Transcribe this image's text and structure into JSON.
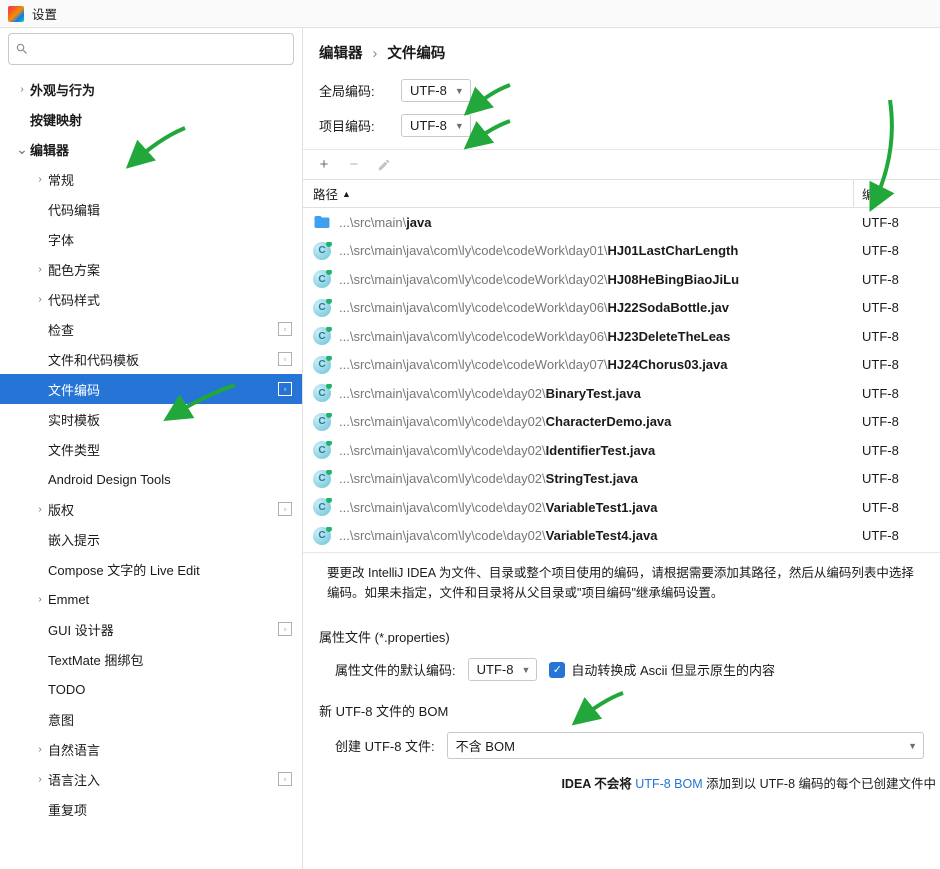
{
  "title": "设置",
  "crumb": {
    "a": "编辑器",
    "b": "文件编码"
  },
  "sidebar": [
    {
      "lvl": 0,
      "exp": "closed",
      "label": "外观与行为"
    },
    {
      "lvl": 0,
      "exp": "none",
      "label": "按键映射"
    },
    {
      "lvl": 0,
      "exp": "open",
      "label": "编辑器"
    },
    {
      "lvl": 1,
      "exp": "closed",
      "label": "常规"
    },
    {
      "lvl": 1,
      "exp": "none",
      "label": "代码编辑"
    },
    {
      "lvl": 1,
      "exp": "none",
      "label": "字体"
    },
    {
      "lvl": 1,
      "exp": "closed",
      "label": "配色方案"
    },
    {
      "lvl": 1,
      "exp": "closed",
      "label": "代码样式"
    },
    {
      "lvl": 1,
      "exp": "none",
      "label": "检查",
      "mark": true
    },
    {
      "lvl": 1,
      "exp": "none",
      "label": "文件和代码模板",
      "mark": true
    },
    {
      "lvl": 1,
      "exp": "none",
      "label": "文件编码",
      "mark": true,
      "sel": true
    },
    {
      "lvl": 1,
      "exp": "none",
      "label": "实时模板"
    },
    {
      "lvl": 1,
      "exp": "none",
      "label": "文件类型"
    },
    {
      "lvl": 1,
      "exp": "none",
      "label": "Android Design Tools"
    },
    {
      "lvl": 1,
      "exp": "closed",
      "label": "版权",
      "mark": true
    },
    {
      "lvl": 1,
      "exp": "none",
      "label": "嵌入提示"
    },
    {
      "lvl": 1,
      "exp": "none",
      "label": "Compose 文字的 Live Edit"
    },
    {
      "lvl": 1,
      "exp": "closed",
      "label": "Emmet"
    },
    {
      "lvl": 1,
      "exp": "none",
      "label": "GUI 设计器",
      "mark": true
    },
    {
      "lvl": 1,
      "exp": "none",
      "label": "TextMate 捆绑包"
    },
    {
      "lvl": 1,
      "exp": "none",
      "label": "TODO"
    },
    {
      "lvl": 1,
      "exp": "none",
      "label": "意图"
    },
    {
      "lvl": 1,
      "exp": "closed",
      "label": "自然语言"
    },
    {
      "lvl": 1,
      "exp": "closed",
      "label": "语言注入",
      "mark": true
    },
    {
      "lvl": 1,
      "exp": "none",
      "label": "重复项"
    }
  ],
  "globalLabel": "全局编码:",
  "globalValue": "UTF-8",
  "projectLabel": "项目编码:",
  "projectValue": "UTF-8",
  "colPath": "路径",
  "colEnc": "编码",
  "rows": [
    {
      "icon": "folder",
      "path": "...\\src\\main\\",
      "bold": "java",
      "enc": "UTF-8"
    },
    {
      "icon": "cls",
      "path": "...\\src\\main\\java\\com\\ly\\code\\codeWork\\day01\\",
      "bold": "HJ01LastCharLength",
      "enc": "UTF-8"
    },
    {
      "icon": "cls",
      "path": "...\\src\\main\\java\\com\\ly\\code\\codeWork\\day02\\",
      "bold": "HJ08HeBingBiaoJiLu",
      "enc": "UTF-8"
    },
    {
      "icon": "cls",
      "path": "...\\src\\main\\java\\com\\ly\\code\\codeWork\\day06\\",
      "bold": "HJ22SodaBottle.jav",
      "enc": "UTF-8"
    },
    {
      "icon": "cls",
      "path": "...\\src\\main\\java\\com\\ly\\code\\codeWork\\day06\\",
      "bold": "HJ23DeleteTheLeas",
      "enc": "UTF-8"
    },
    {
      "icon": "cls",
      "path": "...\\src\\main\\java\\com\\ly\\code\\codeWork\\day07\\",
      "bold": "HJ24Chorus03.java",
      "enc": "UTF-8"
    },
    {
      "icon": "cls",
      "path": "...\\src\\main\\java\\com\\ly\\code\\day02\\",
      "bold": "BinaryTest.java",
      "enc": "UTF-8"
    },
    {
      "icon": "cls",
      "path": "...\\src\\main\\java\\com\\ly\\code\\day02\\",
      "bold": "CharacterDemo.java",
      "enc": "UTF-8"
    },
    {
      "icon": "cls",
      "path": "...\\src\\main\\java\\com\\ly\\code\\day02\\",
      "bold": "IdentifierTest.java",
      "enc": "UTF-8"
    },
    {
      "icon": "cls",
      "path": "...\\src\\main\\java\\com\\ly\\code\\day02\\",
      "bold": "StringTest.java",
      "enc": "UTF-8"
    },
    {
      "icon": "cls",
      "path": "...\\src\\main\\java\\com\\ly\\code\\day02\\",
      "bold": "VariableTest1.java",
      "enc": "UTF-8"
    },
    {
      "icon": "cls",
      "path": "...\\src\\main\\java\\com\\ly\\code\\day02\\",
      "bold": "VariableTest4.java",
      "enc": "UTF-8"
    }
  ],
  "hint": "要更改 IntelliJ IDEA 为文件、目录或整个项目使用的编码，请根据需要添加其路径，然后从编码列表中选择编码。如果未指定，文件和目录将从父目录或\"项目编码\"继承编码设置。",
  "propsTitle": "属性文件 (*.properties)",
  "propsLabel": "属性文件的默认编码:",
  "propsValue": "UTF-8",
  "propsCheckbox": "自动转换成 Ascii 但显示原生的内容",
  "bomTitle": "新 UTF-8 文件的 BOM",
  "bomLabel": "创建 UTF-8 文件:",
  "bomValue": "不含 BOM",
  "foot1": "IDEA 不会将 ",
  "footLink": "UTF-8 BOM",
  "foot2": " 添加到以 UTF-8 编码的每个已创建文件中"
}
